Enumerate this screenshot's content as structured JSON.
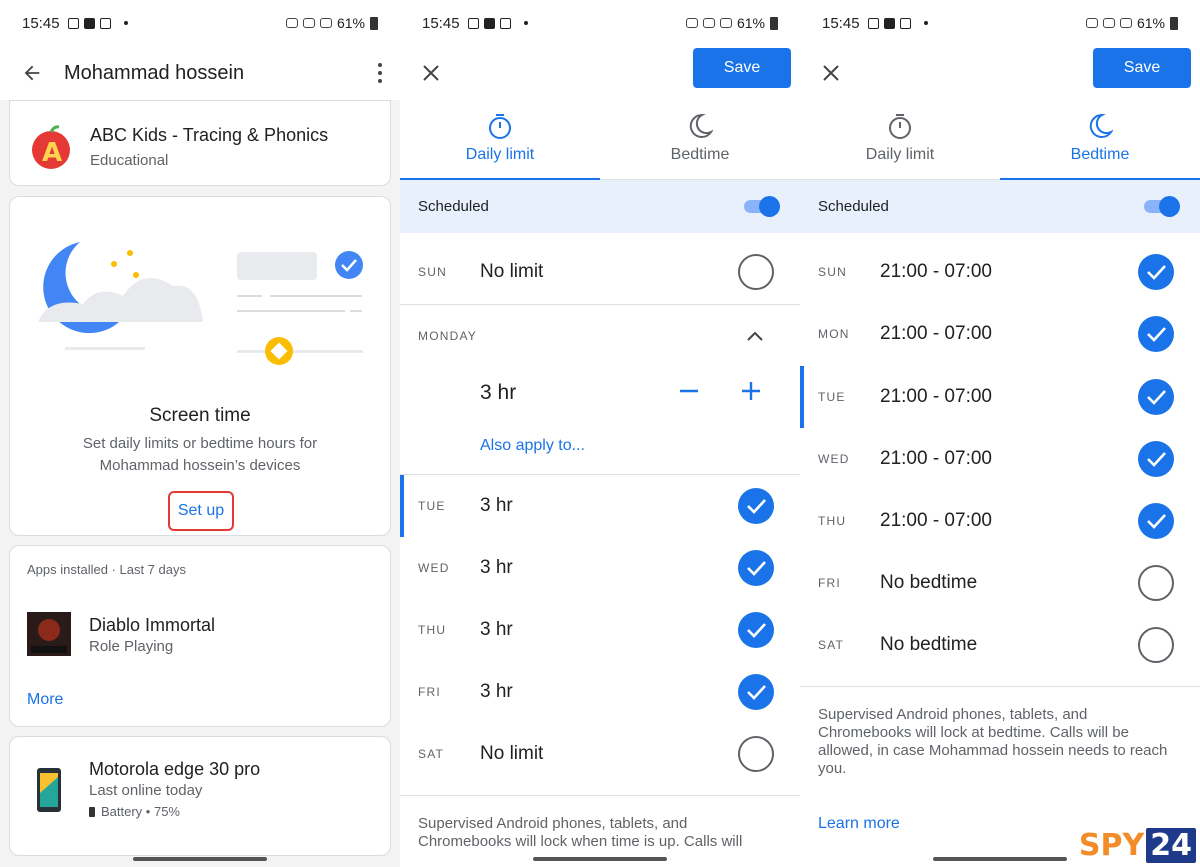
{
  "status": {
    "time": "15:45",
    "battery": "61%"
  },
  "panel1": {
    "title": "Mohammad hossein",
    "app_card": {
      "name": "ABC Kids - Tracing & Phonics",
      "category": "Educational"
    },
    "screen_time": {
      "title": "Screen time",
      "description": "Set daily limits or bedtime hours for Mohammad hossein’s devices",
      "setup_label": "Set up"
    },
    "apps_installed": {
      "header": "Apps installed · Last 7 days",
      "app_name": "Diablo Immortal",
      "app_category": "Role Playing",
      "more_label": "More"
    },
    "device": {
      "name": "Motorola edge 30 pro",
      "status": "Last online today",
      "battery": "Battery • 75%"
    }
  },
  "panel2": {
    "save_label": "Save",
    "tabs": [
      {
        "label": "Daily limit",
        "active": true
      },
      {
        "label": "Bedtime",
        "active": false
      }
    ],
    "scheduled_label": "Scheduled",
    "sun": {
      "day": "SUN",
      "value": "No limit",
      "checked": false
    },
    "monday": {
      "header": "MONDAY",
      "value": "3 hr",
      "also_apply": "Also apply to..."
    },
    "days": [
      {
        "day": "TUE",
        "value": "3 hr",
        "checked": true
      },
      {
        "day": "WED",
        "value": "3 hr",
        "checked": true
      },
      {
        "day": "THU",
        "value": "3 hr",
        "checked": true
      },
      {
        "day": "FRI",
        "value": "3 hr",
        "checked": true
      },
      {
        "day": "SAT",
        "value": "No limit",
        "checked": false
      }
    ],
    "footer": "Supervised Android phones, tablets, and Chromebooks will lock when time is up. Calls will"
  },
  "panel3": {
    "save_label": "Save",
    "tabs": [
      {
        "label": "Daily limit",
        "active": false
      },
      {
        "label": "Bedtime",
        "active": true
      }
    ],
    "scheduled_label": "Scheduled",
    "days": [
      {
        "day": "SUN",
        "value": "21:00 - 07:00",
        "checked": true
      },
      {
        "day": "MON",
        "value": "21:00 - 07:00",
        "checked": true
      },
      {
        "day": "TUE",
        "value": "21:00 - 07:00",
        "checked": true
      },
      {
        "day": "WED",
        "value": "21:00 - 07:00",
        "checked": true
      },
      {
        "day": "THU",
        "value": "21:00 - 07:00",
        "checked": true
      },
      {
        "day": "FRI",
        "value": "No bedtime",
        "checked": false
      },
      {
        "day": "SAT",
        "value": "No bedtime",
        "checked": false
      }
    ],
    "footer": "Supervised Android phones, tablets, and Chromebooks will lock at bedtime. Calls will be allowed, in case Mohammad hossein needs to reach you.",
    "learn_more": "Learn more"
  },
  "watermark": {
    "brand": "SPY",
    "number": "24"
  },
  "colors": {
    "accent": "#1a73e8",
    "highlight": "#e8f0fe",
    "setup_border": "#e53935"
  }
}
